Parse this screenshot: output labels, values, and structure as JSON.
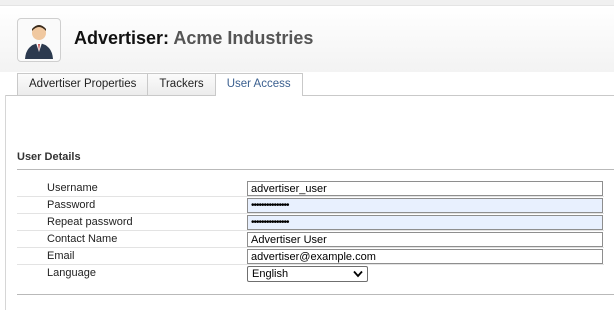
{
  "header": {
    "title_prefix": "Advertiser:",
    "title_name": "Acme Industries",
    "icon": "advertiser-avatar-icon"
  },
  "tabs": [
    {
      "label": "Advertiser Properties",
      "active": false
    },
    {
      "label": "Trackers",
      "active": false
    },
    {
      "label": "User Access",
      "active": true
    }
  ],
  "section": {
    "title": "User Details"
  },
  "form": {
    "username": {
      "label": "Username",
      "value": "advertiser_user"
    },
    "password": {
      "label": "Password",
      "value": "•••••••••••••••"
    },
    "repeat_password": {
      "label": "Repeat password",
      "value": "•••••••••••••••"
    },
    "contact_name": {
      "label": "Contact Name",
      "value": "Advertiser User"
    },
    "email": {
      "label": "Email",
      "value": "advertiser@example.com"
    },
    "language": {
      "label": "Language",
      "value": "English"
    }
  },
  "colors": {
    "active_tab_text": "#3a5f8f",
    "autofill_bg": "#e8f0fe"
  }
}
